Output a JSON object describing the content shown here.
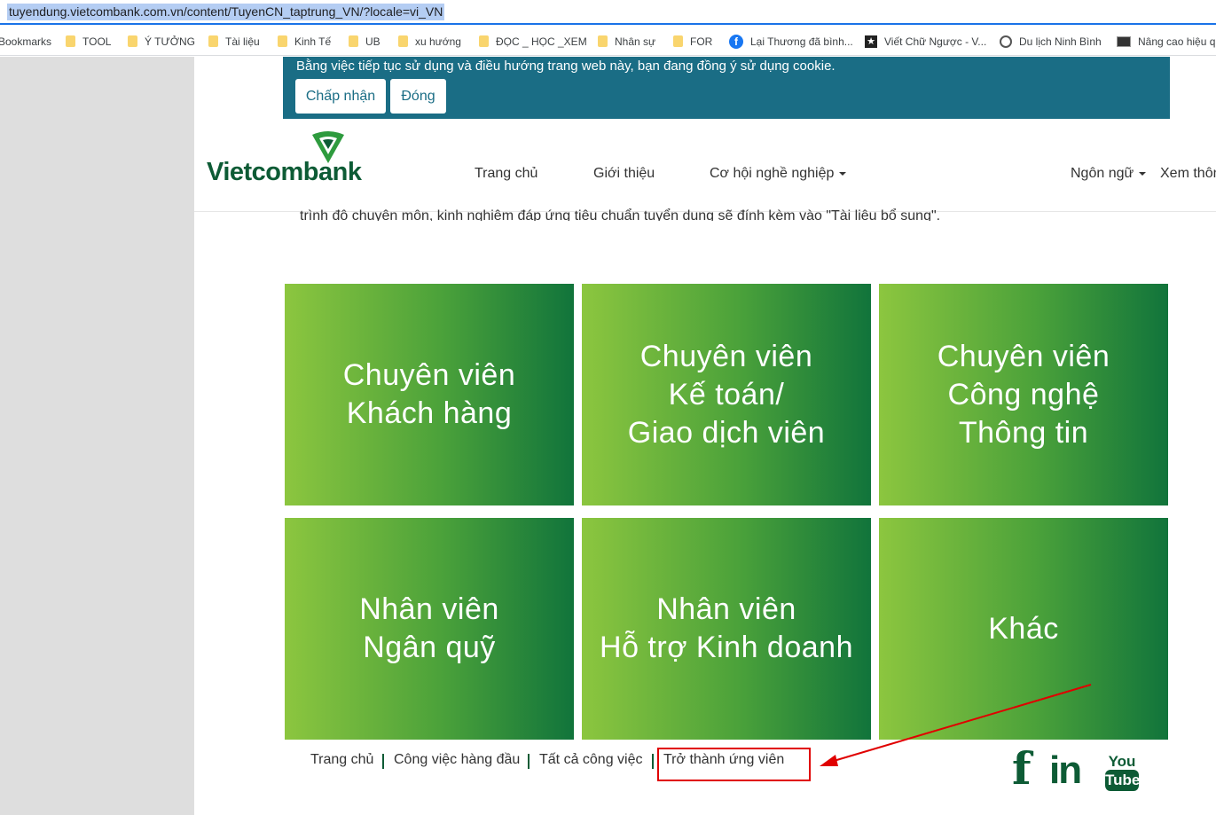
{
  "browser": {
    "url": "tuyendung.vietcombank.com.vn/content/TuyenCN_taptrung_VN/?locale=vi_VN",
    "bookmarks": [
      {
        "label": "Bookmarks",
        "icon": "none"
      },
      {
        "label": "TOOL",
        "icon": "folder-icon"
      },
      {
        "label": "Ý TƯỞNG",
        "icon": "folder-icon"
      },
      {
        "label": "Tài liệu",
        "icon": "folder-icon"
      },
      {
        "label": "Kinh Tế",
        "icon": "folder-icon"
      },
      {
        "label": "UB",
        "icon": "folder-icon"
      },
      {
        "label": "xu hướng",
        "icon": "folder-icon"
      },
      {
        "label": "ĐỌC _ HỌC _XEM",
        "icon": "folder-icon"
      },
      {
        "label": "Nhân sự",
        "icon": "folder-icon"
      },
      {
        "label": "FOR",
        "icon": "folder-icon"
      },
      {
        "label": "Lại Thương đã bình...",
        "icon": "facebook-icon"
      },
      {
        "label": "Viết Chữ Ngược - V...",
        "icon": "star-icon"
      },
      {
        "label": "Du lịch Ninh Bình",
        "icon": "globe-icon"
      },
      {
        "label": "Nâng cao hiệu q",
        "icon": "image-icon"
      }
    ]
  },
  "cookie": {
    "message": "Bằng việc tiếp tục sử dụng và điều hướng trang web này, bạn đang đồng ý sử dụng cookie.",
    "accept_label": "Chấp nhận",
    "close_label": "Đóng"
  },
  "header": {
    "brand": "Vietcombank",
    "nav": {
      "home": "Trang chủ",
      "about": "Giới thiệu",
      "careers": "Cơ hội nghề nghiệp",
      "language": "Ngôn ngữ",
      "more": "Xem thôn"
    }
  },
  "intro_cut": "trình độ chuyên môn, kinh nghiệm đáp ứng tiêu chuẩn tuyển dụng sẽ đính kèm vào \"Tài liệu bổ sung\".",
  "tiles": [
    "Chuyên viên\nKhách hàng",
    "Chuyên viên\nKế toán/\nGiao dịch viên",
    "Chuyên viên\nCông nghệ\nThông tin",
    "Nhân viên\nNgân quỹ",
    "Nhân viên\nHỗ trợ Kinh doanh",
    "Khác"
  ],
  "footer": {
    "home": "Trang chủ",
    "top_jobs": "Công việc hàng đầu",
    "all_jobs": "Tất cả công việc",
    "become_candidate": "Trở thành ứng viên"
  },
  "social": {
    "facebook": "f",
    "linkedin": "in",
    "youtube_top": "You",
    "youtube_bottom": "Tube"
  },
  "colors": {
    "brand_green": "#0d5b35",
    "cookie_bg": "#1a6d85",
    "annotation_red": "#e00000"
  }
}
